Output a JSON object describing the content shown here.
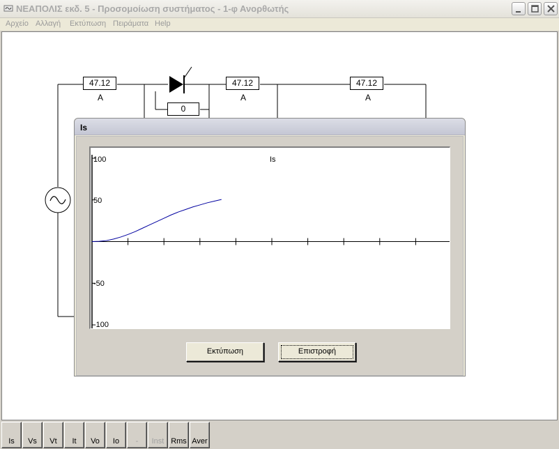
{
  "window": {
    "title": "ΝΕΑΠΟΛΙΣ εκδ. 5 - Προσομοίωση συστήματος - 1-φ Ανορθωτής"
  },
  "menu": [
    "Αρχείο",
    "Αλλαγή",
    "Εκτύπωση",
    "Πειράματα",
    "Help"
  ],
  "circuit": {
    "meter_left": "47.12",
    "meter_left_unit": "A",
    "thyristor_angle": "0",
    "meter_mid": "47.12",
    "meter_mid_unit": "A",
    "meter_right": "47.12",
    "meter_right_unit": "A"
  },
  "dialog": {
    "title": "Is",
    "plot_title": "Is",
    "y_labels": [
      "100",
      "50",
      "-50",
      "-100"
    ],
    "print_button": "Εκτύπωση",
    "back_button": "Επιστροφή"
  },
  "chart_data": {
    "type": "line",
    "title": "Is",
    "ylim": [
      -100,
      100
    ],
    "series": [
      {
        "color": "#0000a0",
        "x": [
          0,
          0.2,
          0.4,
          0.6,
          0.8,
          1.0,
          1.2,
          1.4,
          1.6,
          1.8,
          2.0,
          2.2,
          2.4,
          2.6,
          2.8,
          3.0,
          3.2,
          3.4,
          3.6
        ],
        "values": [
          0,
          0.3,
          1.2,
          3,
          5.5,
          8.5,
          12,
          16,
          20,
          24,
          28,
          32,
          35.5,
          38.5,
          41.5,
          44,
          46.5,
          48.5,
          50.5
        ]
      }
    ],
    "x_ticks": 9,
    "grid": false
  },
  "toolbar": {
    "buttons": [
      {
        "label": "Is",
        "enabled": true
      },
      {
        "label": "Vs",
        "enabled": true
      },
      {
        "label": "Vt",
        "enabled": true
      },
      {
        "label": "It",
        "enabled": true
      },
      {
        "label": "Vo",
        "enabled": true
      },
      {
        "label": "Io",
        "enabled": true
      },
      {
        "label": "-",
        "enabled": false
      },
      {
        "label": "Inst",
        "enabled": false
      },
      {
        "label": "Rms",
        "enabled": true
      },
      {
        "label": "Aver",
        "enabled": true
      }
    ]
  }
}
